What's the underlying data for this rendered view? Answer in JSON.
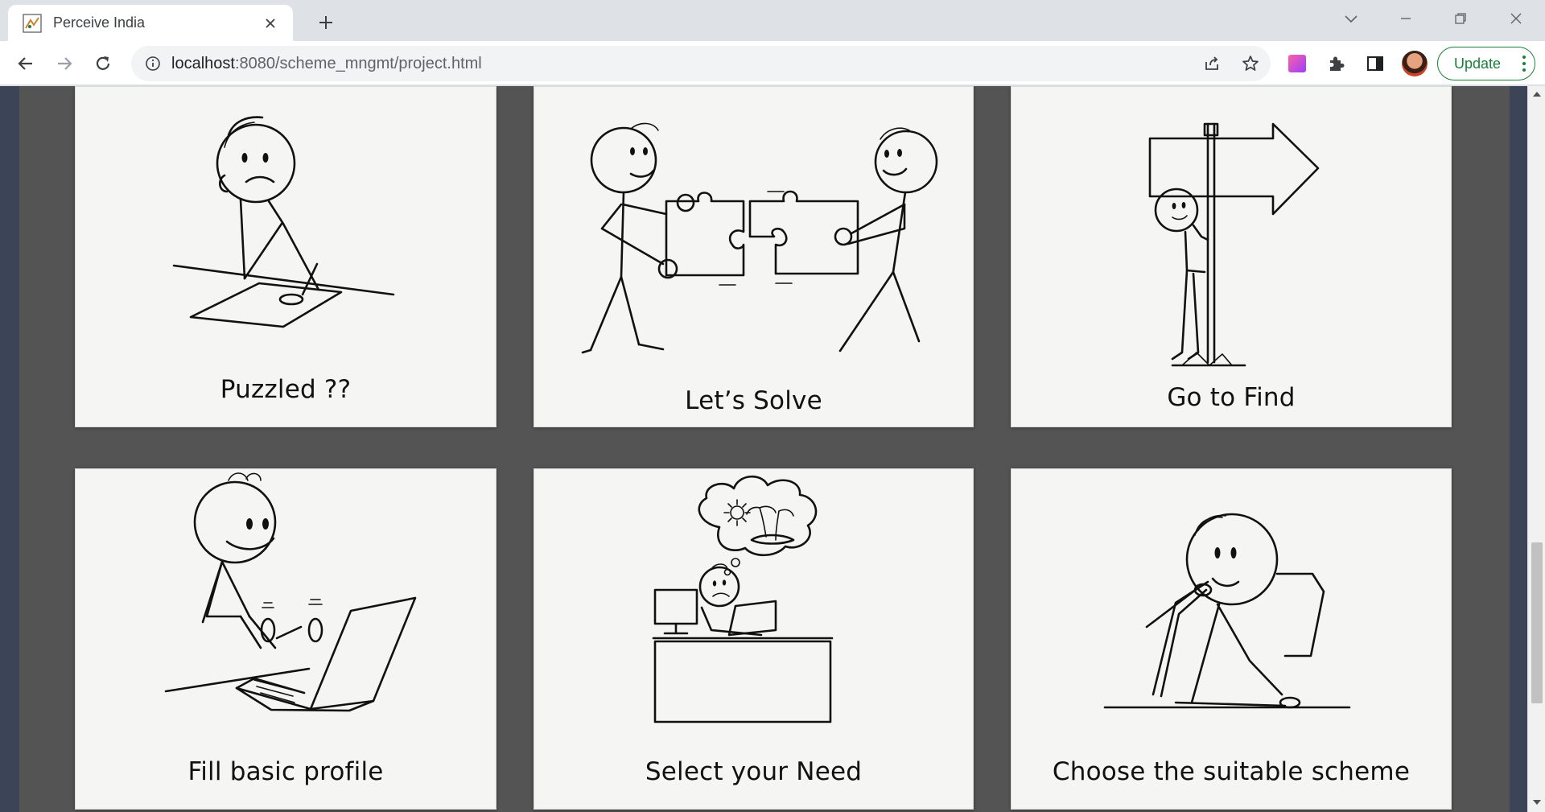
{
  "browser": {
    "tab": {
      "title": "Perceive India",
      "favicon": "perceive-india-favicon"
    },
    "new_tab_icon": "plus-icon",
    "url": {
      "host": "localhost",
      "path": ":8080/scheme_mngmt/project.html"
    },
    "update_label": "Update",
    "colors": {
      "tabstrip": "#dee1e6",
      "update": "#188038",
      "page_bg": "#545454",
      "card_bg": "#f5f5f4"
    }
  },
  "cards": [
    {
      "label": "Puzzled ??",
      "illustration": "puzzled-person-writing"
    },
    {
      "label": "Let’s Solve",
      "illustration": "two-people-joining-puzzle"
    },
    {
      "label": "Go to Find",
      "illustration": "person-behind-signpost"
    },
    {
      "label": "Fill basic profile",
      "illustration": "person-typing-laptop"
    },
    {
      "label": "Select your Need",
      "illustration": "person-at-desk-thinking"
    },
    {
      "label": "Choose the suitable scheme",
      "illustration": "person-thinking-with-pen"
    }
  ]
}
